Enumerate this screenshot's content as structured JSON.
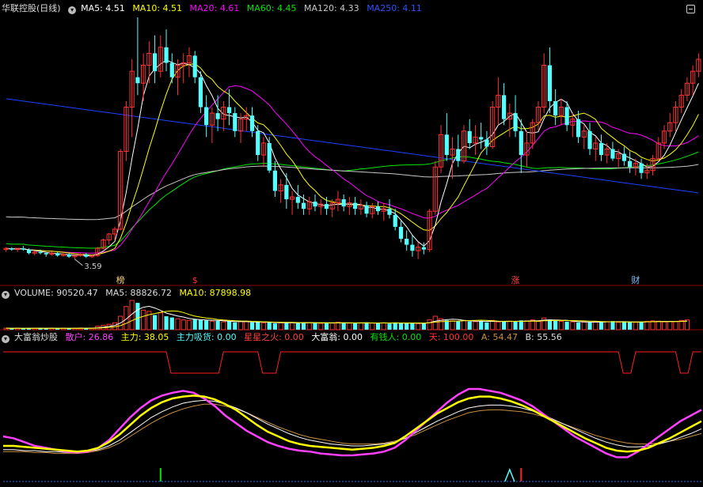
{
  "header": {
    "main": {
      "title": "华联控股(日线)",
      "ma5": "MA5: 4.51",
      "ma10": "MA10: 4.51",
      "ma20": "MA20: 4.61",
      "ma60": "MA60: 4.45",
      "ma120": "MA120: 4.33",
      "ma250": "MA250: 4.11"
    },
    "volume": {
      "title": "VOLUME: 90520.47",
      "ma5": "MA5: 88826.72",
      "ma10": "MA10: 87898.98"
    },
    "indicator": {
      "title": "大富翁炒股",
      "sanhu": "散户: 26.86",
      "zhuli": "主力: 38.05",
      "zhuli_xihuo": "主力吸货: 0.00",
      "xingxing": "星星之火: 0.00",
      "dafuweng": "大富翁: 0.00",
      "youqianren": "有钱人: 0.00",
      "tian": "天: 100.00",
      "a": "A: 54.47",
      "b": "B: 55.56"
    }
  },
  "colors": {
    "up": "#ff3232",
    "down": "#54ffff",
    "ma5": "#ffffff",
    "ma10": "#ffff00",
    "ma20": "#ff00ff",
    "ma60": "#00e600",
    "ma120": "#c8c8c8",
    "ma250": "#1e40ff",
    "grid": "#8b0000"
  },
  "chart_data": [
    {
      "type": "candlestick",
      "series_name": "华联控股(日线)",
      "y_range": [
        3.4,
        5.6
      ],
      "low_marker_label": "3.59",
      "event_labels": [
        {
          "index": 20,
          "text": "榜"
        },
        {
          "index": 33,
          "text": "$"
        },
        {
          "index": 89,
          "text": "涨"
        },
        {
          "index": 110,
          "text": "财"
        }
      ],
      "candles": [
        [
          3.66,
          3.68,
          3.64,
          3.67
        ],
        [
          3.67,
          3.68,
          3.65,
          3.66
        ],
        [
          3.66,
          3.67,
          3.64,
          3.67
        ],
        [
          3.67,
          3.69,
          3.65,
          3.66
        ],
        [
          3.66,
          3.67,
          3.62,
          3.63
        ],
        [
          3.63,
          3.65,
          3.61,
          3.64
        ],
        [
          3.64,
          3.66,
          3.62,
          3.63
        ],
        [
          3.63,
          3.64,
          3.6,
          3.62
        ],
        [
          3.62,
          3.64,
          3.61,
          3.63
        ],
        [
          3.63,
          3.64,
          3.6,
          3.61
        ],
        [
          3.61,
          3.63,
          3.6,
          3.62
        ],
        [
          3.62,
          3.63,
          3.59,
          3.6
        ],
        [
          3.6,
          3.61,
          3.58,
          3.61
        ],
        [
          3.61,
          3.63,
          3.6,
          3.62
        ],
        [
          3.62,
          3.63,
          3.59,
          3.6
        ],
        [
          3.6,
          3.62,
          3.59,
          3.61
        ],
        [
          3.61,
          3.68,
          3.6,
          3.67
        ],
        [
          3.67,
          3.75,
          3.66,
          3.74
        ],
        [
          3.74,
          3.8,
          3.7,
          3.79
        ],
        [
          3.79,
          3.85,
          3.74,
          3.83
        ],
        [
          3.83,
          4.5,
          3.82,
          4.48
        ],
        [
          4.48,
          4.9,
          4.4,
          4.85
        ],
        [
          4.85,
          5.25,
          4.6,
          5.15
        ],
        [
          5.1,
          5.6,
          4.95,
          5.05
        ],
        [
          5.05,
          5.3,
          4.9,
          5.2
        ],
        [
          5.2,
          5.4,
          5.05,
          5.3
        ],
        [
          5.3,
          5.45,
          5.05,
          5.15
        ],
        [
          5.15,
          5.45,
          5.1,
          5.35
        ],
        [
          5.35,
          5.5,
          5.15,
          5.22
        ],
        [
          5.22,
          5.3,
          5.05,
          5.1
        ],
        [
          5.1,
          5.25,
          4.95,
          5.2
        ],
        [
          5.2,
          5.3,
          5.05,
          5.22
        ],
        [
          5.22,
          5.35,
          5.1,
          5.28
        ],
        [
          5.28,
          5.32,
          5.05,
          5.1
        ],
        [
          5.1,
          5.15,
          4.8,
          4.85
        ],
        [
          4.85,
          4.95,
          4.6,
          4.7
        ],
        [
          4.7,
          4.85,
          4.55,
          4.8
        ],
        [
          4.8,
          4.95,
          4.65,
          4.75
        ],
        [
          4.75,
          4.9,
          4.65,
          4.85
        ],
        [
          4.85,
          5.0,
          4.7,
          4.8
        ],
        [
          4.8,
          4.85,
          4.6,
          4.65
        ],
        [
          4.65,
          4.8,
          4.55,
          4.75
        ],
        [
          4.75,
          4.85,
          4.65,
          4.78
        ],
        [
          4.78,
          4.85,
          4.6,
          4.65
        ],
        [
          4.65,
          4.7,
          4.4,
          4.45
        ],
        [
          4.45,
          4.6,
          4.35,
          4.55
        ],
        [
          4.55,
          4.6,
          4.3,
          4.32
        ],
        [
          4.32,
          4.4,
          4.1,
          4.15
        ],
        [
          4.15,
          4.25,
          4.05,
          4.2
        ],
        [
          4.2,
          4.3,
          4.0,
          4.08
        ],
        [
          4.08,
          4.15,
          3.95,
          4.1
        ],
        [
          4.1,
          4.2,
          4.0,
          4.05
        ],
        [
          4.05,
          4.12,
          3.95,
          4.0
        ],
        [
          4.0,
          4.1,
          3.95,
          4.06
        ],
        [
          4.06,
          4.12,
          3.98,
          4.02
        ],
        [
          4.02,
          4.08,
          3.95,
          4.04
        ],
        [
          4.04,
          4.1,
          3.95,
          4.0
        ],
        [
          4.0,
          4.08,
          3.93,
          4.05
        ],
        [
          4.05,
          4.15,
          3.98,
          4.08
        ],
        [
          4.08,
          4.12,
          3.98,
          4.02
        ],
        [
          4.02,
          4.1,
          3.95,
          4.05
        ],
        [
          4.05,
          4.1,
          3.95,
          4.0
        ],
        [
          4.0,
          4.08,
          3.95,
          4.03
        ],
        [
          4.03,
          4.06,
          3.93,
          3.96
        ],
        [
          3.96,
          4.05,
          3.92,
          4.02
        ],
        [
          4.02,
          4.06,
          3.95,
          3.98
        ],
        [
          3.98,
          4.05,
          3.9,
          4.0
        ],
        [
          4.0,
          4.08,
          3.92,
          3.95
        ],
        [
          3.95,
          4.0,
          3.82,
          3.85
        ],
        [
          3.85,
          3.9,
          3.72,
          3.75
        ],
        [
          3.75,
          3.82,
          3.65,
          3.7
        ],
        [
          3.7,
          3.78,
          3.6,
          3.65
        ],
        [
          3.65,
          3.72,
          3.58,
          3.68
        ],
        [
          3.68,
          3.72,
          3.62,
          3.66
        ],
        [
          3.66,
          4.0,
          3.64,
          3.98
        ],
        [
          3.98,
          4.4,
          3.95,
          4.35
        ],
        [
          4.35,
          4.7,
          4.3,
          4.62
        ],
        [
          4.62,
          4.8,
          4.4,
          4.45
        ],
        [
          4.45,
          4.6,
          4.25,
          4.5
        ],
        [
          4.5,
          4.62,
          4.35,
          4.4
        ],
        [
          4.4,
          4.7,
          4.38,
          4.65
        ],
        [
          4.65,
          4.75,
          4.5,
          4.55
        ],
        [
          4.55,
          4.7,
          4.45,
          4.6
        ],
        [
          4.6,
          4.72,
          4.5,
          4.58
        ],
        [
          4.58,
          4.65,
          4.45,
          4.52
        ],
        [
          4.52,
          4.9,
          4.5,
          4.85
        ],
        [
          4.85,
          5.1,
          4.7,
          4.95
        ],
        [
          4.95,
          5.05,
          4.7,
          4.75
        ],
        [
          4.75,
          4.88,
          4.6,
          4.8
        ],
        [
          4.8,
          4.95,
          4.6,
          4.65
        ],
        [
          4.65,
          4.75,
          4.3,
          4.45
        ],
        [
          4.45,
          4.65,
          4.35,
          4.55
        ],
        [
          4.55,
          4.75,
          4.5,
          4.72
        ],
        [
          4.72,
          4.9,
          4.65,
          4.85
        ],
        [
          4.85,
          5.3,
          4.8,
          5.2
        ],
        [
          5.2,
          5.35,
          4.8,
          4.9
        ],
        [
          4.9,
          5.0,
          4.7,
          4.78
        ],
        [
          4.78,
          4.92,
          4.7,
          4.85
        ],
        [
          4.85,
          4.9,
          4.65,
          4.7
        ],
        [
          4.7,
          4.8,
          4.6,
          4.75
        ],
        [
          4.75,
          4.82,
          4.55,
          4.6
        ],
        [
          4.6,
          4.7,
          4.5,
          4.65
        ],
        [
          4.65,
          4.72,
          4.45,
          4.5
        ],
        [
          4.5,
          4.6,
          4.4,
          4.55
        ],
        [
          4.55,
          4.62,
          4.4,
          4.45
        ],
        [
          4.45,
          4.55,
          4.38,
          4.5
        ],
        [
          4.5,
          4.56,
          4.4,
          4.42
        ],
        [
          4.42,
          4.5,
          4.35,
          4.46
        ],
        [
          4.46,
          4.52,
          4.36,
          4.4
        ],
        [
          4.4,
          4.48,
          4.3,
          4.35
        ],
        [
          4.35,
          4.42,
          4.28,
          4.38
        ],
        [
          4.38,
          4.42,
          4.25,
          4.3
        ],
        [
          4.3,
          4.38,
          4.25,
          4.32
        ],
        [
          4.32,
          4.45,
          4.28,
          4.42
        ],
        [
          4.42,
          4.6,
          4.4,
          4.55
        ],
        [
          4.55,
          4.7,
          4.5,
          4.65
        ],
        [
          4.65,
          4.8,
          4.6,
          4.72
        ],
        [
          4.72,
          4.9,
          4.65,
          4.85
        ],
        [
          4.85,
          5.0,
          4.8,
          4.95
        ],
        [
          4.95,
          5.1,
          4.9,
          5.05
        ],
        [
          5.05,
          5.2,
          4.95,
          5.15
        ],
        [
          5.15,
          5.3,
          5.1,
          5.25
        ]
      ]
    },
    {
      "type": "bar",
      "series_name": "VOLUME",
      "values_note_units": "hands",
      "values": [
        6,
        5,
        6,
        5,
        7,
        6,
        6,
        5,
        6,
        5,
        6,
        5,
        6,
        7,
        6,
        6,
        14,
        18,
        22,
        28,
        55,
        95,
        120,
        110,
        80,
        75,
        60,
        70,
        55,
        50,
        45,
        40,
        38,
        42,
        40,
        38,
        35,
        36,
        32,
        34,
        30,
        33,
        34,
        30,
        32,
        28,
        30,
        26,
        28,
        30,
        28,
        27,
        30,
        29,
        28,
        26,
        28,
        27,
        30,
        28,
        27,
        26,
        28,
        30,
        27,
        26,
        28,
        25,
        30,
        28,
        26,
        27,
        25,
        26,
        40,
        55,
        45,
        38,
        36,
        35,
        38,
        34,
        33,
        35,
        30,
        38,
        32,
        34,
        35,
        33,
        38,
        36,
        40,
        34,
        48,
        42,
        36,
        34,
        33,
        32,
        30,
        31,
        30,
        32,
        34,
        33,
        35,
        30,
        32,
        31,
        30,
        33,
        34,
        36,
        35,
        32,
        34,
        33,
        38,
        40
      ]
    },
    {
      "type": "line",
      "series_name": "大富翁炒股",
      "y_range": [
        0,
        100
      ],
      "series": [
        {
          "name": "散户",
          "color": "#ff40ff",
          "values": [
            40,
            38,
            34,
            30,
            28,
            26,
            24,
            23,
            24,
            28,
            36,
            48,
            60,
            70,
            78,
            83,
            86,
            88,
            86,
            80,
            72,
            62,
            54,
            46,
            40,
            34,
            30,
            27,
            25,
            24,
            22,
            21,
            20,
            20,
            21,
            22,
            24,
            28,
            36,
            46,
            56,
            66,
            76,
            84,
            90,
            90,
            88,
            86,
            82,
            78,
            72,
            64,
            56,
            48,
            40,
            34,
            28,
            22,
            18,
            18,
            24,
            32,
            40,
            48,
            56,
            62,
            68
          ]
        },
        {
          "name": "主力",
          "color": "#ffff00",
          "values": [
            30,
            30,
            29,
            28,
            27,
            26,
            25,
            24,
            25,
            28,
            34,
            42,
            52,
            62,
            70,
            76,
            80,
            82,
            83,
            82,
            79,
            74,
            68,
            60,
            52,
            45,
            40,
            35,
            32,
            30,
            29,
            28,
            27,
            26,
            27,
            28,
            30,
            33,
            40,
            48,
            56,
            64,
            70,
            76,
            80,
            82,
            82,
            80,
            77,
            73,
            68,
            62,
            56,
            50,
            44,
            38,
            33,
            28,
            25,
            24,
            25,
            28,
            33,
            38,
            44,
            50,
            56
          ]
        },
        {
          "name": "A",
          "color": "#ffffff",
          "values": [
            26,
            26,
            25,
            25,
            24,
            24,
            23,
            23,
            24,
            26,
            30,
            36,
            44,
            52,
            60,
            66,
            71,
            75,
            77,
            78,
            77,
            74,
            70,
            65,
            59,
            53,
            48,
            43,
            39,
            36,
            34,
            32,
            31,
            30,
            30,
            31,
            32,
            34,
            38,
            44,
            50,
            56,
            61,
            66,
            70,
            72,
            73,
            73,
            72,
            70,
            67,
            63,
            58,
            53,
            48,
            43,
            38,
            34,
            31,
            29,
            29,
            30,
            32,
            35,
            39,
            43,
            48
          ]
        },
        {
          "name": "B",
          "color": "#c89040",
          "values": [
            24,
            24,
            24,
            23,
            23,
            22,
            22,
            22,
            23,
            25,
            28,
            33,
            40,
            47,
            54,
            60,
            65,
            69,
            72,
            74,
            74,
            72,
            69,
            65,
            60,
            55,
            50,
            46,
            42,
            39,
            37,
            35,
            33,
            32,
            32,
            32,
            33,
            35,
            38,
            42,
            47,
            52,
            57,
            61,
            65,
            67,
            68,
            68,
            67,
            66,
            64,
            61,
            57,
            53,
            49,
            45,
            41,
            38,
            35,
            33,
            32,
            32,
            33,
            35,
            37,
            40,
            43
          ]
        }
      ],
      "top_signal_dips": [
        {
          "from": 28,
          "to": 38
        },
        {
          "from": 44,
          "to": 48
        },
        {
          "from": 107,
          "to": 110
        },
        {
          "from": 117,
          "to": 120
        }
      ],
      "bottom_signals": [
        {
          "index": 27,
          "color": "#00e600"
        },
        {
          "index": 90,
          "color": "#ff2020"
        },
        {
          "index": 88,
          "color": "#54ffff"
        }
      ]
    }
  ]
}
